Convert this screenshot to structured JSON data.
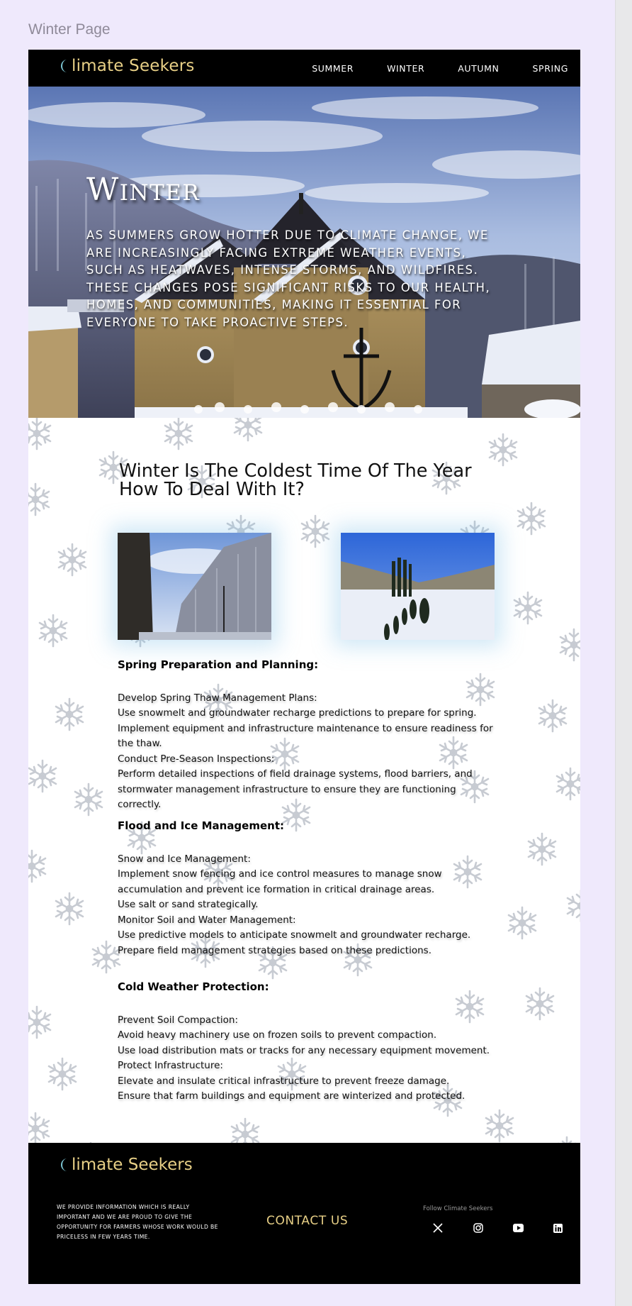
{
  "page_label": "Winter Page",
  "brand": {
    "name": "limate Seekers",
    "logo_letter": "C",
    "color": "#e7cf86",
    "moon_color": "#7ec8d6"
  },
  "nav": {
    "items": [
      "SUMMER",
      "WINTER",
      "AUTUMN",
      "SPRING"
    ]
  },
  "hero": {
    "title": "Winter",
    "text": "As summers grow hotter due to climate change, we are increasingly facing extreme weather events, such as heatwaves, intense storms, and wildfires. These changes pose significant risks to our health, homes, and communities, making it essential for everyone to take proactive steps."
  },
  "main": {
    "heading_line1": "Winter Is The Coldest Time Of The Year",
    "heading_line2": "How To Deal With It?",
    "photo_left": "winter-forest-road-photo",
    "photo_right": "snowy-park-photo",
    "sections": [
      {
        "title": "Spring Preparation and Planning:",
        "lines": [
          "Develop Spring Thaw Management Plans:",
          "Use snowmelt and groundwater recharge predictions to prepare for spring.",
          "Implement equipment and infrastructure maintenance to ensure readiness for the thaw.",
          "Conduct Pre-Season Inspections:",
          "Perform detailed inspections of field drainage systems, flood barriers, and stormwater management infrastructure to ensure they are functioning correctly."
        ]
      },
      {
        "title": "Flood and Ice Management:",
        "lines": [
          "Snow and Ice Management:",
          "Implement snow fencing and ice control measures to manage snow accumulation and prevent ice formation in critical drainage areas.",
          "Use salt or sand strategically.",
          "Monitor Soil and Water Management:",
          "Use predictive models to anticipate snowmelt and groundwater recharge.",
          "Prepare field management strategies based on these predictions."
        ]
      },
      {
        "title": "Cold Weather Protection:",
        "lines": [
          "Prevent Soil Compaction:",
          "Avoid heavy machinery use on frozen soils to prevent compaction.",
          "Use load distribution mats or tracks for any necessary equipment movement.",
          "Protect Infrastructure:",
          "Elevate and insulate critical infrastructure to prevent freeze damage.",
          "Ensure that farm buildings and equipment are winterized and protected."
        ]
      }
    ]
  },
  "footer": {
    "about": "We provide information which is really important and we are proud to give the opportunity for farmers whose work would be priceless in few years time.",
    "contact": "CONTACT US",
    "follow": "Follow Climate Seekers",
    "social_icons": [
      "x-icon",
      "instagram-icon",
      "youtube-icon",
      "linkedin-icon"
    ]
  }
}
